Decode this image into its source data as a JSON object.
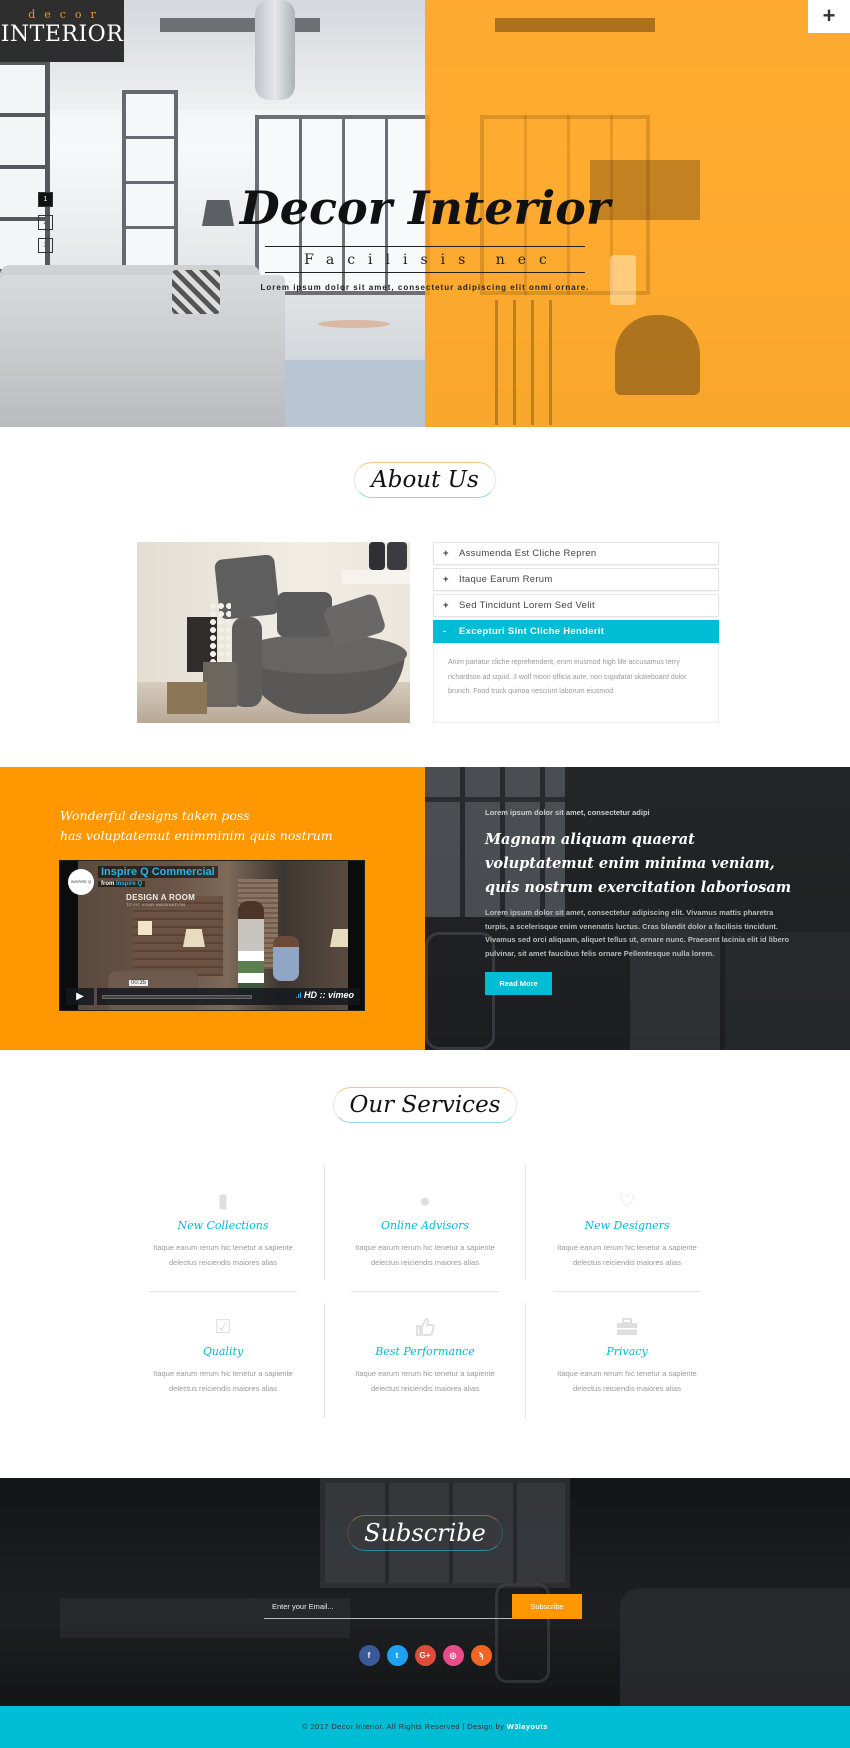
{
  "brand": {
    "logo_small": "decor",
    "logo_big": "INTERIOR"
  },
  "hero": {
    "title": "Decor Interior",
    "subtitle": "Facilisis nec",
    "description": "Lorem ipsum dolor sit amet, consectetur adipiscing elit onmi ornare.",
    "slides": [
      "1",
      "2",
      "3"
    ],
    "active_slide": 1,
    "menu_icon": "plus-icon"
  },
  "about": {
    "title": "About Us",
    "accordion": [
      {
        "label": "Assumenda Est Cliche Repren",
        "open": false
      },
      {
        "label": "Itaque Earum Rerum",
        "open": false
      },
      {
        "label": "Sed Tincidunt Lorem Sed Velit",
        "open": false
      },
      {
        "label": "Excepturi Sint Cliche Henderit",
        "open": true
      }
    ],
    "open_body": "Anim pariatur cliche reprehenderit, enim eiusmod high life accusamus terry richardson ad squid. 3 wolf moon officia aute, non cupidatat skateboard dolor brunch. Food truck quinoa nesciunt laborum eiusmod.",
    "collapsed_sign": "+",
    "expanded_sign": "-"
  },
  "video_section": {
    "tagline_line1": "Wonderful designs taken poss",
    "tagline_line2": "has voluptatemut enimminim quis nostrum",
    "video": {
      "title": "Inspire Q Commercial",
      "from_prefix": "from",
      "from_name": "Inspire Q",
      "overlay_title": "DESIGN A ROOM",
      "overlay_sub": "TO FIT YOUR IMAGINATION",
      "logo_text": "INSPIRE Q",
      "time": "00:35",
      "hd_label": "HD",
      "provider": "vimeo",
      "play_icon": "▶"
    },
    "kicker": "Lorem ipsum dolor sit amet, consectetur adipi",
    "headline": "Magnam aliquam quaerat voluptatemut enim minima veniam, quis nostrum exercitation laboriosam",
    "paragraph": "Lorem ipsum dolor sit amet, consectetur adipiscing elit. Vivamus mattis pharetra turpis, a scelerisque enim venenatis luctus. Cras blandit dolor a facilisis tincidunt. Vivamus sed orci aliquam, aliquet tellus ut, ornare nunc. Praesent lacinia elit id libero pulvinar, sit amet faucibus felis ornare Pellentesque nulla lorem.",
    "button": "Read More"
  },
  "services": {
    "title": "Our Services",
    "items": [
      {
        "icon": "bar-chart-icon",
        "glyph": "▮",
        "name": "New Collections",
        "desc1": "Itaque earum rerum hic tenetur a sapiente",
        "desc2": "delectus reiciendis maiores alias"
      },
      {
        "icon": "user-icon",
        "glyph": "●",
        "name": "Online Advisors",
        "desc1": "Itaque earum rerum hic tenetur a sapiente",
        "desc2": "delectus reiciendis maiores alias"
      },
      {
        "icon": "heart-icon",
        "glyph": "♡",
        "name": "New Designers",
        "desc1": "Itaque earum rerum hic tenetur a sapiente",
        "desc2": "delectus reiciendis maiores alias"
      },
      {
        "icon": "check-square-icon",
        "glyph": "☑",
        "name": "Quality",
        "desc1": "Itaque earum rerum hic tenetur a sapiente",
        "desc2": "delectus reiciendis maiores alias"
      },
      {
        "icon": "thumbs-up-icon",
        "glyph": "👍",
        "name": "Best Performance",
        "desc1": "Itaque earum rerum hic tenetur a sapiente",
        "desc2": "delectus reiciendis maiores alias"
      },
      {
        "icon": "briefcase-icon",
        "glyph": "▬",
        "name": "Privacy",
        "desc1": "Itaque earum rerum hic tenetur a sapiente",
        "desc2": "delectus reiciendis maiores alias"
      }
    ]
  },
  "subscribe": {
    "title": "Subscribe",
    "email_placeholder": "Enter your Email...",
    "email_value": "",
    "button": "Subscribe",
    "socials": [
      {
        "name": "facebook",
        "glyph": "f",
        "color": "#3b5998"
      },
      {
        "name": "twitter",
        "glyph": "t",
        "color": "#1da1f2"
      },
      {
        "name": "google-plus",
        "glyph": "G+",
        "color": "#dd4b39"
      },
      {
        "name": "dribbble",
        "glyph": "◎",
        "color": "#ea4c89"
      },
      {
        "name": "rss",
        "glyph": "ϡ",
        "color": "#f26522"
      }
    ]
  },
  "footer": {
    "text": "© 2017 Decor Interior. All Rights Reserved | Design by",
    "link": "W3layouts"
  },
  "colors": {
    "accent_orange": "#ff9800",
    "accent_cyan": "#00bcd4",
    "dark": "#1c1d20"
  }
}
